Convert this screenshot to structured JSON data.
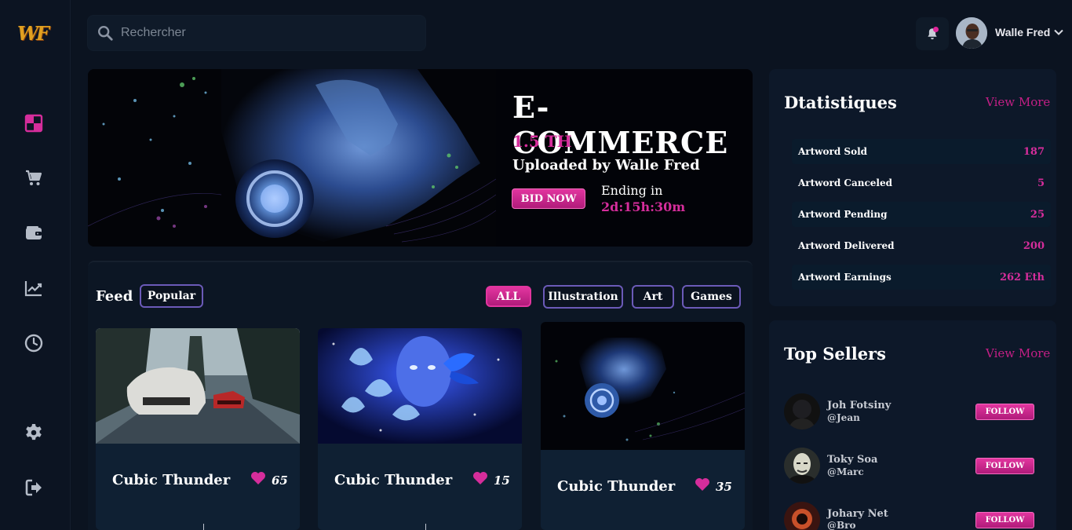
{
  "app": {
    "logo_text": "WF",
    "search_placeholder": "Rechercher",
    "user": {
      "name": "Walle Fred"
    }
  },
  "sidebar": {
    "items": [
      {
        "icon": "dashboard-icon",
        "active": true
      },
      {
        "icon": "cart-icon"
      },
      {
        "icon": "wallet-icon"
      },
      {
        "icon": "chart-icon"
      },
      {
        "icon": "clock-icon"
      },
      {
        "icon": "gear-icon"
      },
      {
        "icon": "logout-icon"
      }
    ]
  },
  "hero": {
    "title": "E-COMMERCE",
    "price": "1.5 TH",
    "uploaded_by": "Uploaded by Walle Fred",
    "bid_label": "BID NOW",
    "ending_label": "Ending in",
    "ending_value": "2d:15h:30m"
  },
  "feed": {
    "label": "Feed",
    "sort_label": "Popular",
    "filters": [
      "ALL",
      "Illustration",
      "Art",
      "Games"
    ],
    "active_filter": "ALL",
    "cards": [
      {
        "title": "Cubic Thunder",
        "likes": "65"
      },
      {
        "title": "Cubic Thunder",
        "likes": "15"
      },
      {
        "title": "Cubic Thunder",
        "likes": "35"
      }
    ]
  },
  "stats": {
    "title": "Dtatistiques",
    "view_more": "View More",
    "rows": [
      {
        "label": "Artword Sold",
        "value": "187"
      },
      {
        "label": "Artword Canceled",
        "value": "5"
      },
      {
        "label": "Artword Pending",
        "value": "25"
      },
      {
        "label": "Artword Delivered",
        "value": "200"
      },
      {
        "label": "Artword Earnings",
        "value": "262 Eth"
      }
    ]
  },
  "sellers": {
    "title": "Top Sellers",
    "view_more": "View More",
    "follow_label": "FOLLOW",
    "items": [
      {
        "name": "Joh Fotsiny",
        "handle": "@Jean"
      },
      {
        "name": "Toky Soa",
        "handle": "@Marc"
      },
      {
        "name": "Johary Net",
        "handle": "@Bro"
      }
    ]
  },
  "colors": {
    "background": "#0b1320",
    "panel": "#0d1829",
    "accent": "#d52d9b",
    "pill_border": "#6b5ab8"
  }
}
